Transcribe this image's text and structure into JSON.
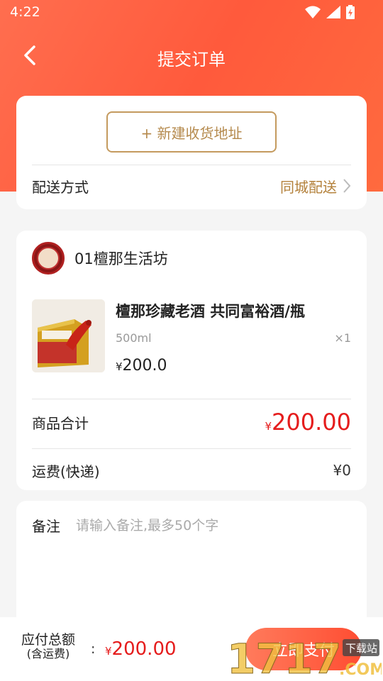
{
  "status_bar": {
    "time": "4:22"
  },
  "header": {
    "title": "提交订单"
  },
  "address": {
    "new_address_label": "+ 新建收货地址",
    "delivery_label": "配送方式",
    "delivery_value": "同城配送"
  },
  "shop": {
    "name": "01檀那生活坊"
  },
  "product": {
    "name": "檀那珍藏老酒 共同富裕酒/瓶",
    "spec": "500ml",
    "qty": "×1",
    "currency": "¥",
    "price": "200.0"
  },
  "summary": {
    "subtotal_label": "商品合计",
    "currency": "¥",
    "subtotal_value": "200.00",
    "shipping_label": "运费(快递)",
    "shipping_value": "¥0"
  },
  "note": {
    "label": "备注",
    "placeholder": "请输入备注,最多50个字"
  },
  "footer": {
    "total_label_line1": "应付总额",
    "total_label_line2": "(含运费)",
    "colon": ":",
    "currency": "¥",
    "total_value": "200.00",
    "pay_button": "立即支付"
  },
  "watermark": {
    "text": "1717",
    "suffix": ".COM",
    "badge": "下载站"
  },
  "colors": {
    "accent": "#ff5a3c",
    "price_red": "#e51c1c",
    "gold": "#b58a4d"
  }
}
